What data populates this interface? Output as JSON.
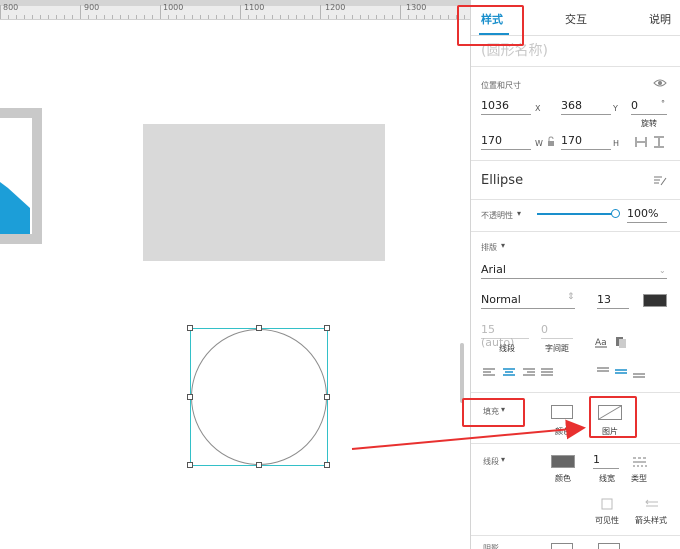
{
  "ruler": {
    "labels": [
      "800",
      "900",
      "1000",
      "1100",
      "1200",
      "1300"
    ]
  },
  "tabs": [
    {
      "label": "样式",
      "active": true
    },
    {
      "label": "交互",
      "active": false
    },
    {
      "label": "说明",
      "active": false
    }
  ],
  "shape_name_placeholder": "(圆形名称)",
  "position_size": {
    "title": "位置和尺寸",
    "x": "1036",
    "x_label": "X",
    "y": "368",
    "y_label": "Y",
    "rotation": "0",
    "rotation_unit": "°",
    "rotation_label": "旋转",
    "w": "170",
    "w_label": "W",
    "h": "170",
    "h_label": "H"
  },
  "shape_type": "Ellipse",
  "opacity": {
    "label": "不透明性",
    "value": "100%",
    "level": 1.0
  },
  "typography": {
    "title": "排版",
    "font_family": "Arial",
    "font_weight": "Normal",
    "font_size": "13",
    "line_height": "15 (auto)",
    "letter_spacing": "0",
    "line_height_label": "线段",
    "letter_spacing_label": "字间距"
  },
  "fill": {
    "label": "填充",
    "color_label": "颜色",
    "image_label": "图片"
  },
  "border": {
    "label": "线段",
    "color_label": "颜色",
    "width": "1",
    "width_label": "线宽",
    "type_label": "类型",
    "visibility_label": "可见性",
    "arrow_label": "箭头样式"
  },
  "shadow_label": "阴影",
  "colors": {
    "accent": "#1a8fcc",
    "highlight": "#e8302f",
    "selection": "#33c0c8"
  }
}
